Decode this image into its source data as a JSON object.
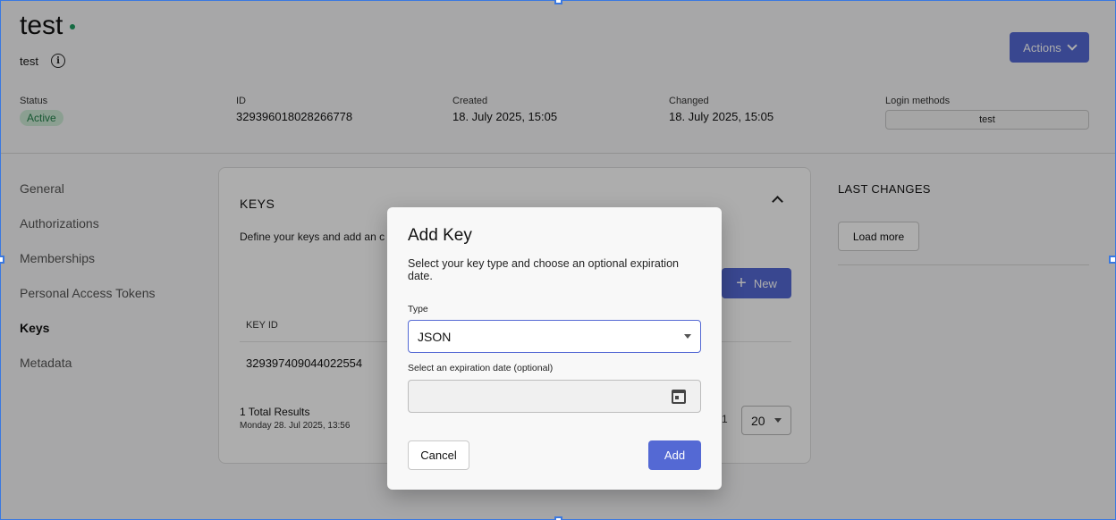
{
  "header": {
    "title": "test",
    "subtitle": "test",
    "actions_label": "Actions"
  },
  "meta": {
    "status_label": "Status",
    "status_value": "Active",
    "id_label": "ID",
    "id_value": "329396018028266778",
    "created_label": "Created",
    "created_value": "18. July 2025, 15:05",
    "changed_label": "Changed",
    "changed_value": "18. July 2025, 15:05",
    "login_label": "Login methods",
    "login_value": "test"
  },
  "nav": {
    "items": [
      {
        "label": "General"
      },
      {
        "label": "Authorizations"
      },
      {
        "label": "Memberships"
      },
      {
        "label": "Personal Access Tokens"
      },
      {
        "label": "Keys"
      },
      {
        "label": "Metadata"
      }
    ],
    "active": "Keys"
  },
  "keys_card": {
    "title": "KEYS",
    "description": "Define your keys and add an c",
    "new_label": "New",
    "column_key_id": "KEY ID",
    "rows": [
      {
        "key_id": "329397409044022554"
      }
    ],
    "total": "1 Total Results",
    "total_date": "Monday 28. Jul 2025, 13:56",
    "page_number": "1",
    "page_size": "20"
  },
  "last_changes": {
    "title": "LAST CHANGES",
    "load_more": "Load more"
  },
  "dialog": {
    "title": "Add Key",
    "description": "Select your key type and choose an optional expiration date.",
    "type_label": "Type",
    "type_value": "JSON",
    "expiration_label": "Select an expiration date (optional)",
    "expiration_value": "",
    "cancel_label": "Cancel",
    "add_label": "Add"
  },
  "colors": {
    "accent": "#5469d4",
    "status_green": "#23814a",
    "selection": "#3a78e0"
  }
}
